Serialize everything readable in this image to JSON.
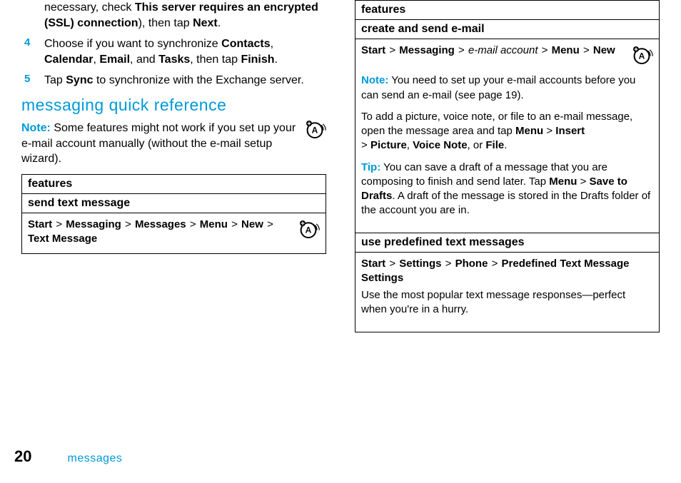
{
  "left": {
    "step0": {
      "pre": "necessary, check ",
      "bold": "This server requires an encrypted (SSL) connection",
      "post1": "), then tap ",
      "bold2": "Next",
      "post2": "."
    },
    "step4": {
      "num": "4",
      "t1": "Choose if you want to synchronize ",
      "b1": "Contacts",
      "c1": ", ",
      "b2": "Calendar",
      "c2": ", ",
      "b3": "Email",
      "c3": ", and ",
      "b4": "Tasks",
      "c4": ", then tap ",
      "b5": "Finish",
      "c5": "."
    },
    "step5": {
      "num": "5",
      "t1": "Tap ",
      "b1": "Sync",
      "t2": " to synchronize with the Exchange server."
    },
    "heading": "messaging quick reference",
    "noteLabel": "Note:",
    "noteText": " Some features might not work if you set up your e-mail account manually (without the e-mail setup wizard).",
    "table": {
      "hdr": "features",
      "sub1": "send text message",
      "path": {
        "p1": "Start",
        "p2": "Messaging",
        "p3": "Messages",
        "p4": "Menu",
        "p5": "New",
        "p6": "Text Message"
      }
    }
  },
  "right": {
    "table": {
      "hdr": "features",
      "sub1": "create and send e-mail",
      "row1": {
        "path": {
          "p1": "Start",
          "p2": "Messaging",
          "p3i": "e-mail account",
          "p4": "Menu",
          "p5": "New"
        },
        "noteLabel": "Note:",
        "noteText": " You need to set up your e-mail accounts before you can send an e-mail (see page 19).",
        "para2a": "To add a picture, voice note, or file to an e-mail message, open the message area and tap ",
        "para2b1": "Menu",
        "gt1": " > ",
        "para2b2": "Insert",
        "para2c": " > ",
        "para2d1": "Picture",
        "comma1": ", ",
        "para2d2": "Voice Note",
        "comma2": ", or ",
        "para2d3": "File",
        "period": ".",
        "tipLabel": "Tip:",
        "tipText1": " You can save a draft of a message that you are composing to finish and send later. Tap ",
        "tipB1": "Menu",
        "tipGt": " > ",
        "tipB2": "Save to Drafts",
        "tipText2": ". A draft of the message is stored in the Drafts folder of the account you are in."
      },
      "sub2": "use predefined text messages",
      "row2": {
        "path": {
          "p1": "Start",
          "p2": "Settings",
          "p3": "Phone",
          "p4": "Predefined Text Message Settings"
        },
        "text": "Use the most popular text message responses—perfect when you're in a hurry."
      }
    }
  },
  "footer": {
    "page": "20",
    "section": "messages"
  },
  "gt": ">"
}
